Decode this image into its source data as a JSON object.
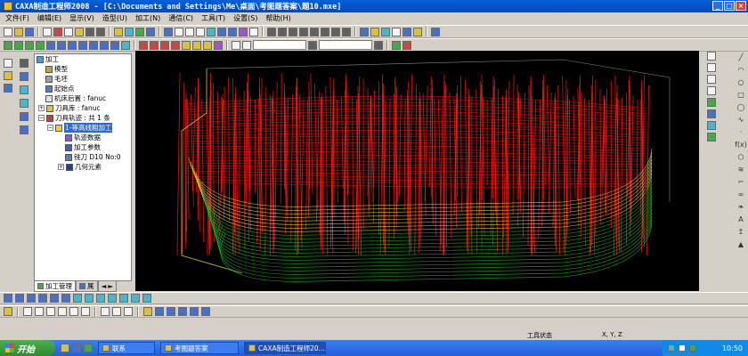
{
  "window": {
    "title": "CAXA制造工程师2008 - [C:\\Documents and Settings\\Me\\桌面\\考图题答案\\题10.mxe]",
    "min_glyph": "_",
    "max_glyph": "□",
    "close_glyph": "×"
  },
  "menu": {
    "items": [
      "文件(F)",
      "编辑(E)",
      "显示(V)",
      "造型(U)",
      "加工(N)",
      "通信(C)",
      "工具(T)",
      "设置(S)",
      "帮助(H)"
    ]
  },
  "toolbar": {
    "combo_left": "",
    "combo_right": ""
  },
  "tree": {
    "root": "加工",
    "items": [
      {
        "label": "模型",
        "indent": 1
      },
      {
        "label": "毛坯",
        "indent": 1
      },
      {
        "label": "起始点",
        "indent": 1
      },
      {
        "label": "机床后置 : fanuc",
        "indent": 1
      },
      {
        "label": "刀具库 : fanuc",
        "indent": 1
      },
      {
        "label": "刀具轨迹 : 共 1 条",
        "indent": 1
      },
      {
        "label": "1-等高线粗加工",
        "indent": 2
      },
      {
        "label": "轨迹数据",
        "indent": 3
      },
      {
        "label": "加工参数",
        "indent": 3
      },
      {
        "label": "铣刀 D10 No:0",
        "indent": 3
      },
      {
        "label": "几何元素",
        "indent": 3
      }
    ]
  },
  "panel_tabs": {
    "tab1": "加工管理",
    "tab2": "属"
  },
  "right_glyphs": {
    "f": "f(x)",
    "a": "A"
  },
  "status": {
    "tool_state": "工具状态",
    "coords": "X, Y, Z"
  },
  "taskbar": {
    "start": "开始",
    "tasks": [
      "联系",
      "考图题答案",
      "CAXA制造工程师20..."
    ],
    "clock": "10:50"
  },
  "colors": {
    "titlebar": "#0a5fd8",
    "toolpath_red": "#ff1a1a",
    "toolpath_yellow": "#e8e040",
    "toolpath_green": "#20c020",
    "viewport_bg": "#000000",
    "selection": "#316ac5"
  }
}
